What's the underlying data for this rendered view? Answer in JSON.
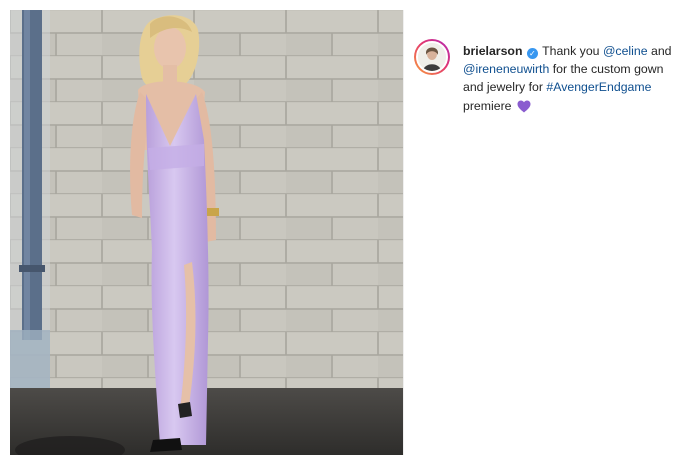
{
  "post": {
    "author": {
      "username": "brielarson",
      "verified": true,
      "verified_icon": "verified-badge-icon"
    },
    "caption": {
      "text_1": "Thank you",
      "mention_1": "@celine",
      "text_2": "and",
      "mention_2": "@ireneneuwirth",
      "text_3": "for the custom gown and jewelry for",
      "hashtag": "#AvengerEndgame",
      "text_4": "premiere",
      "emoji_icon": "purple-heart-icon"
    },
    "photo": {
      "subject": "woman in lavender satin gown against brick wall"
    }
  },
  "colors": {
    "link": "#0f4f8f",
    "verified": "#3897f0",
    "gown": "#c9b3e8",
    "wall": "#c7c5bd",
    "heart": "#8a5ccf"
  }
}
